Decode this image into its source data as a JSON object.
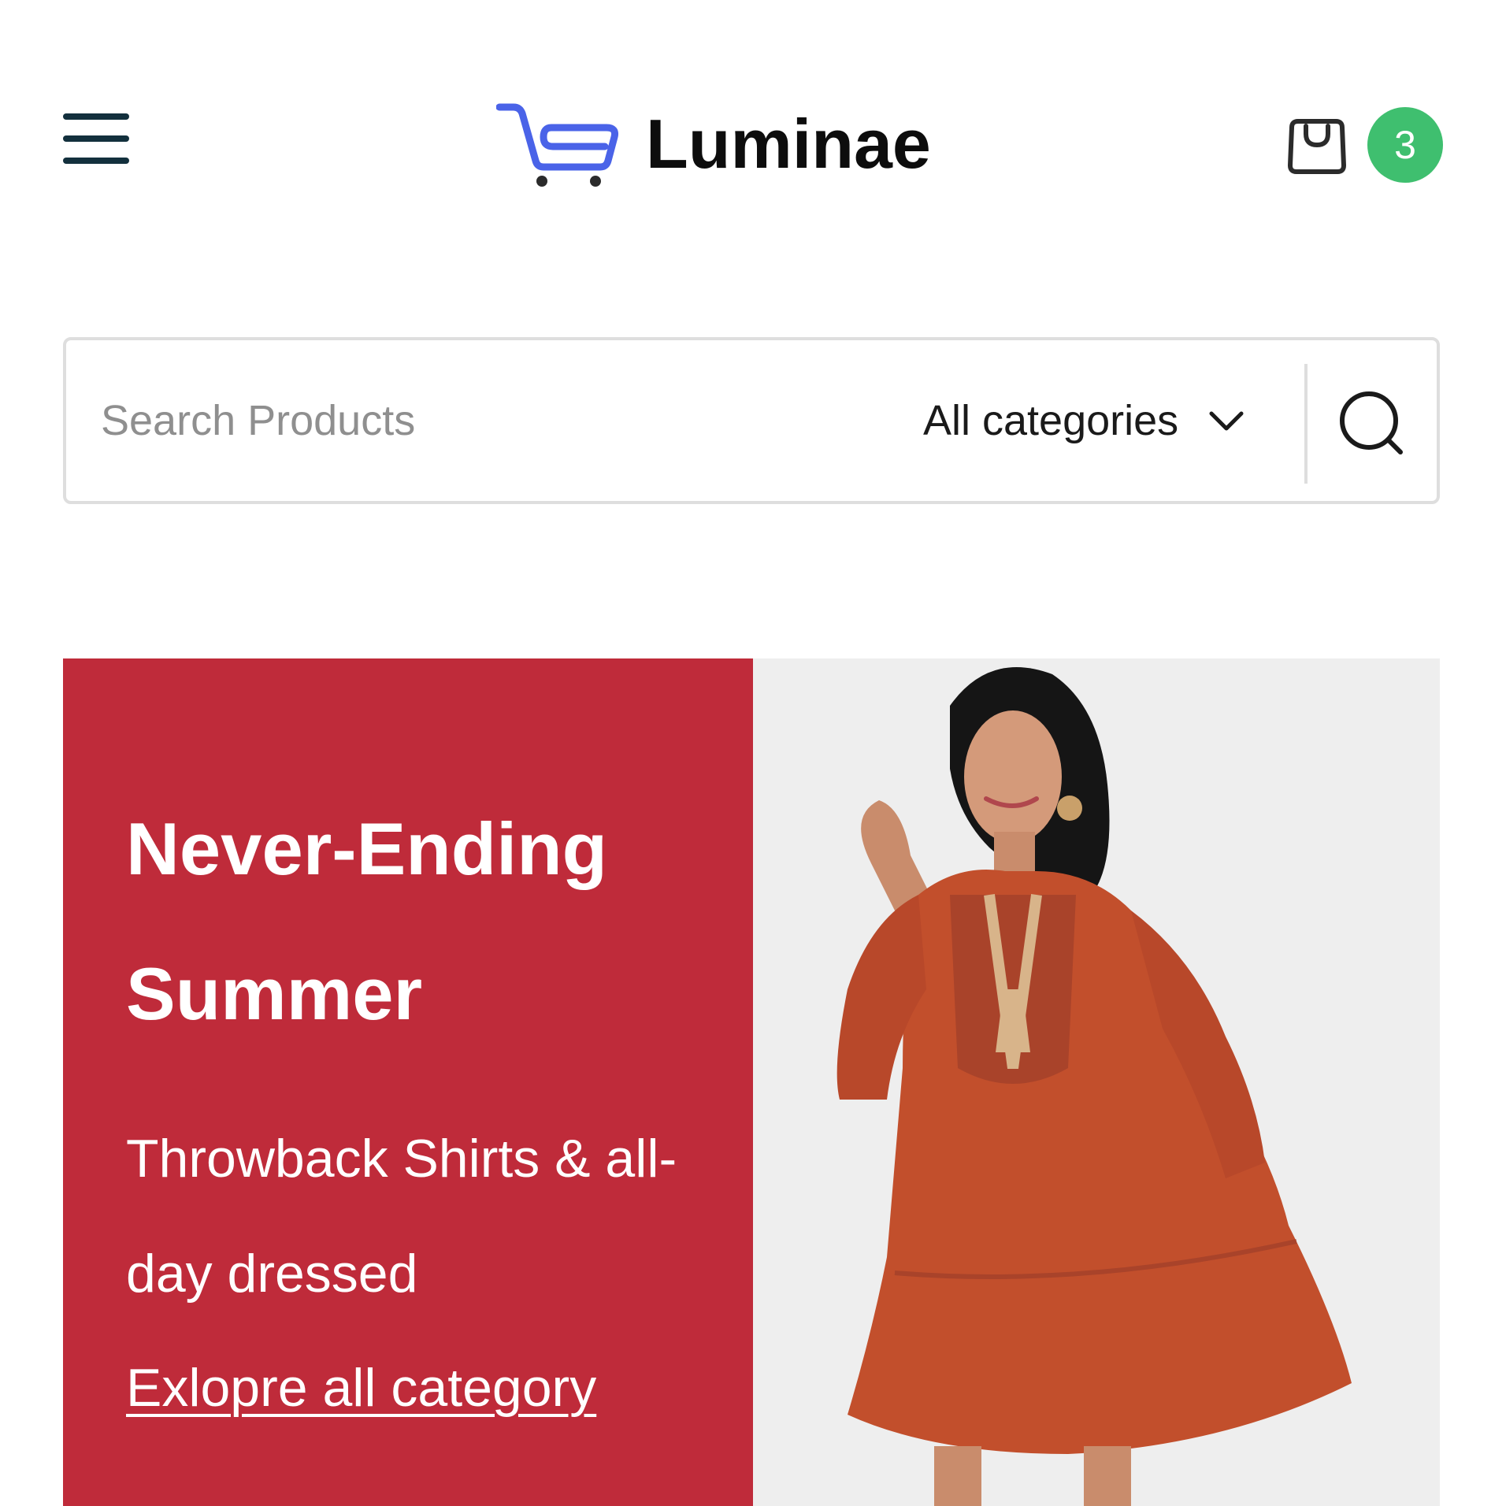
{
  "header": {
    "menu_icon": "hamburger-menu-icon",
    "brand_logo_icon": "shopping-cart-icon",
    "brand_name": "Luminae",
    "cart_icon": "shopping-bag-icon",
    "cart_count": "3"
  },
  "search": {
    "placeholder": "Search Products",
    "value": "",
    "category": "All categories",
    "category_icon": "chevron-down-icon",
    "submit_icon": "search-icon"
  },
  "hero": {
    "title": "Never-Ending Summer",
    "subtitle": "Throwback Shirts & all-day dressed",
    "link": "Exlopre all category"
  },
  "colors": {
    "hero_background": "#bf2b3a",
    "badge": "#3fbf6f",
    "brand_accent": "#4a63e8",
    "text_dark": "#0d0d0d"
  }
}
